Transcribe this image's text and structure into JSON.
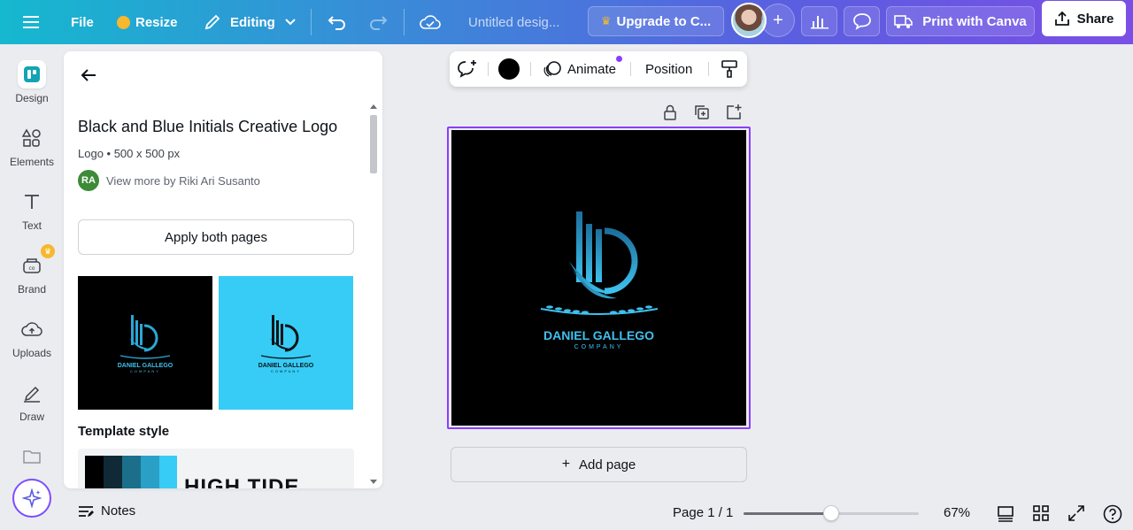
{
  "topbar": {
    "file_label": "File",
    "resize_label": "Resize",
    "editing_label": "Editing",
    "doc_title": "Untitled desig...",
    "upgrade_label": "Upgrade to C...",
    "print_label": "Print with Canva",
    "share_label": "Share"
  },
  "rail": {
    "items": [
      {
        "label": "Design"
      },
      {
        "label": "Elements"
      },
      {
        "label": "Text"
      },
      {
        "label": "Brand"
      },
      {
        "label": "Uploads"
      },
      {
        "label": "Draw"
      }
    ]
  },
  "panel": {
    "title": "Black and Blue Initials Creative Logo",
    "meta": "Logo • 500 x 500 px",
    "author_initials": "RA",
    "author_text": "View more by Riki Ari Susanto",
    "apply_label": "Apply both pages",
    "template_style_heading": "Template style",
    "style_name": "HIGH TIDE",
    "thumb_name": "DANIEL GALLEGO",
    "thumb_sub": "COMPANY",
    "swatches": [
      "#000000",
      "#0f2a36",
      "#1b6f8a",
      "#2aa0c7",
      "#36ccf5"
    ]
  },
  "toolbar": {
    "animate_label": "Animate",
    "position_label": "Position"
  },
  "canvas": {
    "logo_name": "DANIEL GALLEGO",
    "logo_sub": "COMPANY",
    "add_page_label": "Add page"
  },
  "bottombar": {
    "notes_label": "Notes",
    "page_indicator": "Page 1 / 1",
    "zoom_level": "67%",
    "zoom_fraction": 0.5
  },
  "colors": {
    "accent": "#8b3dff",
    "logo_blue": "#3ec1ee",
    "light_thumb_bg": "#36ccf5"
  }
}
